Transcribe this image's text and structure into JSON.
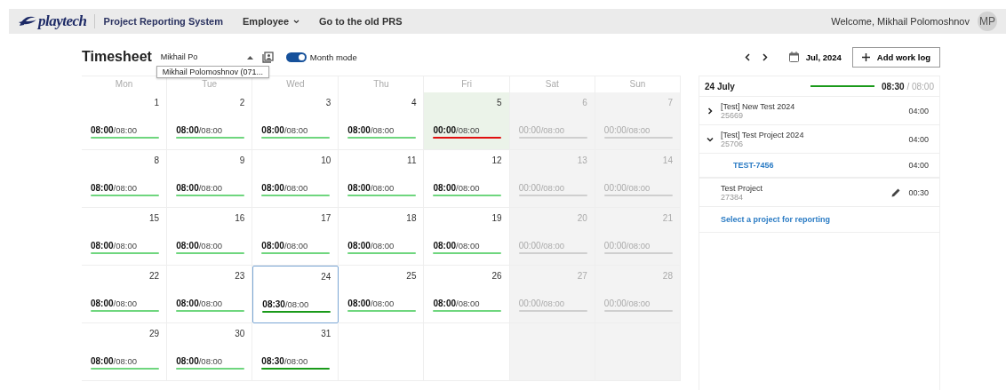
{
  "header": {
    "logo": "playtech",
    "app_title": "Project Reporting System",
    "nav": [
      {
        "label": "Employee",
        "kind": "menu"
      },
      {
        "label": "Go to the old PRS",
        "kind": "link"
      }
    ],
    "welcome": "Welcome, Mikhail Polomoshnov",
    "avatar": "MP"
  },
  "toolbar": {
    "title": "Timesheet",
    "employee": {
      "value": "Mikhail Po",
      "expanded": true,
      "suggestion": "Mikhail Polomoshnov (071..."
    },
    "month_mode": {
      "label": "Month mode",
      "on": true
    },
    "period": "Jul, 2024",
    "add_button": "Add work log"
  },
  "weekdays": [
    "Mon",
    "Tue",
    "Wed",
    "Thu",
    "Fri",
    "Sat",
    "Sun"
  ],
  "days": [
    {
      "kind": "workday",
      "day": "1",
      "logged": "08:00",
      "expected": "/08:00",
      "color": "#6fd67e",
      "selected": false
    },
    {
      "kind": "workday",
      "day": "2",
      "logged": "08:00",
      "expected": "/08:00",
      "color": "#6fd67e",
      "selected": false
    },
    {
      "kind": "workday",
      "day": "3",
      "logged": "08:00",
      "expected": "/08:00",
      "color": "#6fd67e",
      "selected": false
    },
    {
      "kind": "workday",
      "day": "4",
      "logged": "08:00",
      "expected": "/08:00",
      "color": "#6fd67e",
      "selected": false
    },
    {
      "kind": "today",
      "day": "5",
      "logged": "00:00",
      "expected": "/08:00",
      "color": "#e01010",
      "selected": false
    },
    {
      "kind": "weekend",
      "day": "6",
      "logged": "00:00",
      "expected": "/08:00",
      "color": "#cfcfcf",
      "selected": false
    },
    {
      "kind": "weekend",
      "day": "7",
      "logged": "00:00",
      "expected": "/08:00",
      "color": "#cfcfcf",
      "selected": false
    },
    {
      "kind": "workday",
      "day": "8",
      "logged": "08:00",
      "expected": "/08:00",
      "color": "#6fd67e",
      "selected": false
    },
    {
      "kind": "workday",
      "day": "9",
      "logged": "08:00",
      "expected": "/08:00",
      "color": "#6fd67e",
      "selected": false
    },
    {
      "kind": "workday",
      "day": "10",
      "logged": "08:00",
      "expected": "/08:00",
      "color": "#6fd67e",
      "selected": false
    },
    {
      "kind": "workday",
      "day": "11",
      "logged": "08:00",
      "expected": "/08:00",
      "color": "#6fd67e",
      "selected": false
    },
    {
      "kind": "workday",
      "day": "12",
      "logged": "08:00",
      "expected": "/08:00",
      "color": "#6fd67e",
      "selected": false
    },
    {
      "kind": "weekend",
      "day": "13",
      "logged": "00:00",
      "expected": "/08:00",
      "color": "#cfcfcf",
      "selected": false
    },
    {
      "kind": "weekend",
      "day": "14",
      "logged": "00:00",
      "expected": "/08:00",
      "color": "#cfcfcf",
      "selected": false
    },
    {
      "kind": "workday",
      "day": "15",
      "logged": "08:00",
      "expected": "/08:00",
      "color": "#6fd67e",
      "selected": false
    },
    {
      "kind": "workday",
      "day": "16",
      "logged": "08:00",
      "expected": "/08:00",
      "color": "#6fd67e",
      "selected": false
    },
    {
      "kind": "workday",
      "day": "17",
      "logged": "08:00",
      "expected": "/08:00",
      "color": "#6fd67e",
      "selected": false
    },
    {
      "kind": "workday",
      "day": "18",
      "logged": "08:00",
      "expected": "/08:00",
      "color": "#6fd67e",
      "selected": false
    },
    {
      "kind": "workday",
      "day": "19",
      "logged": "08:00",
      "expected": "/08:00",
      "color": "#6fd67e",
      "selected": false
    },
    {
      "kind": "weekend",
      "day": "20",
      "logged": "00:00",
      "expected": "/08:00",
      "color": "#cfcfcf",
      "selected": false
    },
    {
      "kind": "weekend",
      "day": "21",
      "logged": "00:00",
      "expected": "/08:00",
      "color": "#cfcfcf",
      "selected": false
    },
    {
      "kind": "workday",
      "day": "22",
      "logged": "08:00",
      "expected": "/08:00",
      "color": "#6fd67e",
      "selected": false
    },
    {
      "kind": "workday",
      "day": "23",
      "logged": "08:00",
      "expected": "/08:00",
      "color": "#6fd67e",
      "selected": false
    },
    {
      "kind": "workday",
      "day": "24",
      "logged": "08:30",
      "expected": "/08:00",
      "color": "#1a9a1a",
      "selected": true
    },
    {
      "kind": "workday",
      "day": "25",
      "logged": "08:00",
      "expected": "/08:00",
      "color": "#6fd67e",
      "selected": false
    },
    {
      "kind": "workday",
      "day": "26",
      "logged": "08:00",
      "expected": "/08:00",
      "color": "#6fd67e",
      "selected": false
    },
    {
      "kind": "weekend",
      "day": "27",
      "logged": "00:00",
      "expected": "/08:00",
      "color": "#cfcfcf",
      "selected": false
    },
    {
      "kind": "weekend",
      "day": "28",
      "logged": "00:00",
      "expected": "/08:00",
      "color": "#cfcfcf",
      "selected": false
    },
    {
      "kind": "workday",
      "day": "29",
      "logged": "08:00",
      "expected": "/08:00",
      "color": "#6fd67e",
      "selected": false
    },
    {
      "kind": "workday",
      "day": "30",
      "logged": "08:00",
      "expected": "/08:00",
      "color": "#6fd67e",
      "selected": false
    },
    {
      "kind": "workday",
      "day": "31",
      "logged": "08:30",
      "expected": "/08:00",
      "color": "#1a9a1a",
      "selected": false
    },
    {
      "kind": "blank"
    },
    {
      "kind": "blank"
    },
    {
      "kind": "blank"
    },
    {
      "kind": "blank"
    }
  ],
  "day_panel": {
    "date": "24 July",
    "logged": "08:30",
    "expected": "/ 08:00",
    "color": "#1a9a1a",
    "entries": [
      {
        "kind": "group",
        "name": "[Test] New Test 2024",
        "code": "25669",
        "time": "04:00",
        "expanded": false
      },
      {
        "kind": "group",
        "name": "[Test] Test Project 2024",
        "code": "25706",
        "time": "04:00",
        "expanded": true,
        "children": [
          {
            "name": "TEST-7456",
            "time": "04:00"
          }
        ]
      },
      {
        "kind": "entry",
        "name": "Test Project",
        "code": "27384",
        "time": "00:30"
      }
    ],
    "select_link": "Select a project for reporting"
  }
}
